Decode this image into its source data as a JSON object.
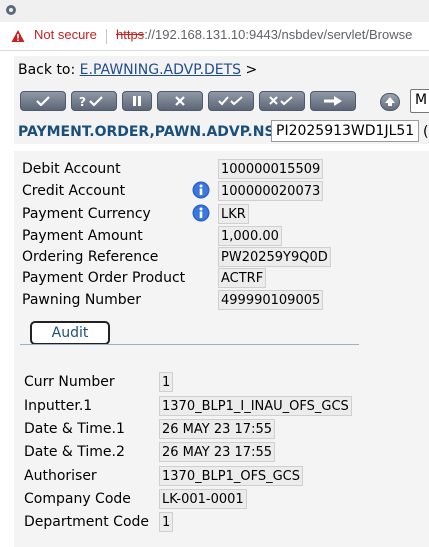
{
  "browser": {
    "security_label": "Not secure",
    "url_scheme": "https",
    "url_rest": "://192.168.131.10:9443/nsbdev/servlet/Browse"
  },
  "nav": {
    "back_to_label": "Back to:",
    "back_to_link": "E.PAWNING.ADVP.DETS",
    "back_to_chevron": ">",
    "select_value": "M"
  },
  "toolbar": {
    "buttons": [
      "commit",
      "validate",
      "hold",
      "delete",
      "authorise",
      "reverse",
      "next"
    ],
    "extra_button": "up-arrow"
  },
  "header": {
    "application": "PAYMENT.ORDER,PAWN.ADVP.NSB",
    "record_id": "PI2025913WD1JL51",
    "trail": "(N"
  },
  "fields": [
    {
      "label": "Debit Account",
      "value": "100000015509",
      "info": false
    },
    {
      "label": "Credit Account",
      "value": "100000020073",
      "info": true
    },
    {
      "label": "Payment Currency",
      "value": "LKR",
      "info": true
    },
    {
      "label": "Payment Amount",
      "value": "1,000.00",
      "info": false
    },
    {
      "label": "Ordering Reference",
      "value": "PW20259Y9Q0D",
      "info": false
    },
    {
      "label": "Payment Order Product",
      "value": "ACTRF",
      "info": false
    },
    {
      "label": "Pawning Number",
      "value": "499990109005",
      "info": false
    }
  ],
  "audit": {
    "tab_label": "Audit",
    "fields": [
      {
        "label": "Curr Number",
        "value": "1"
      },
      {
        "label": "Inputter.1",
        "value": "1370_BLP1_I_INAU_OFS_GCS"
      },
      {
        "label": "Date & Time.1",
        "value": "26 MAY 23 17:55"
      },
      {
        "label": "Date & Time.2",
        "value": "26 MAY 23 17:55"
      },
      {
        "label": "Authoriser",
        "value": "1370_BLP1_OFS_GCS"
      },
      {
        "label": "Company Code",
        "value": "LK-001-0001"
      },
      {
        "label": "Department Code",
        "value": "1"
      }
    ]
  },
  "colors": {
    "warning_red": "#c5221f",
    "header_blue": "#1a4f7a",
    "link_blue": "#1f4e8c",
    "info_blue": "#2a62c9"
  }
}
